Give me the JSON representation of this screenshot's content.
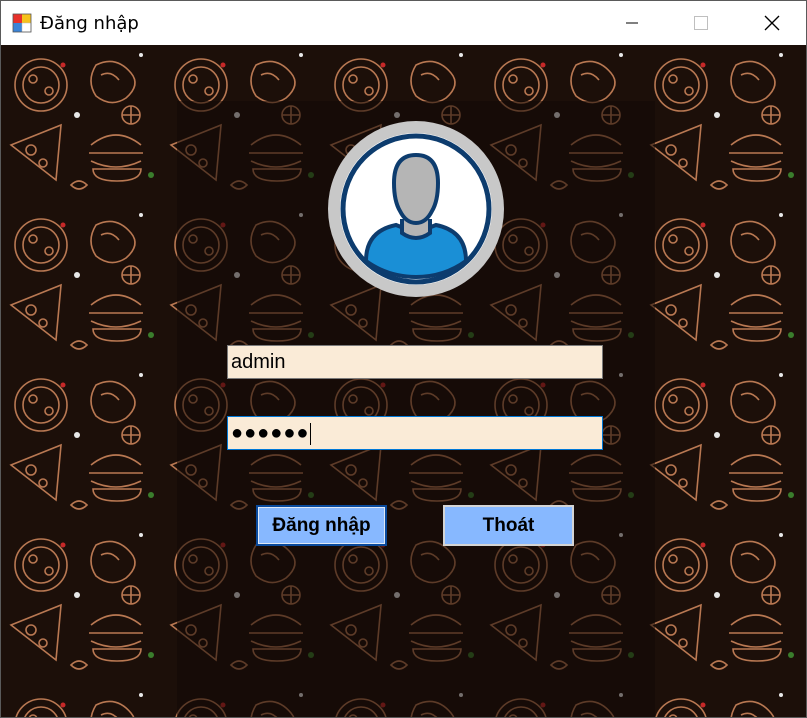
{
  "window": {
    "title": "Đăng nhập",
    "icon": "app-icon",
    "controls": [
      "minimize-icon",
      "maximize-icon",
      "close-icon"
    ]
  },
  "login_form": {
    "avatar_icon": "user-avatar-icon",
    "username_value": "admin",
    "password_value": "●●●●●●",
    "login_button": "Đăng nhập",
    "exit_button": "Thoát"
  },
  "colors": {
    "background": "#1a0e08",
    "doodle_line": "#c98a62",
    "input_bg": "#faebd7",
    "button_bg": "#87b8ff",
    "avatar_blue": "#1a8fd6",
    "avatar_ring": "#0d3c6e"
  }
}
